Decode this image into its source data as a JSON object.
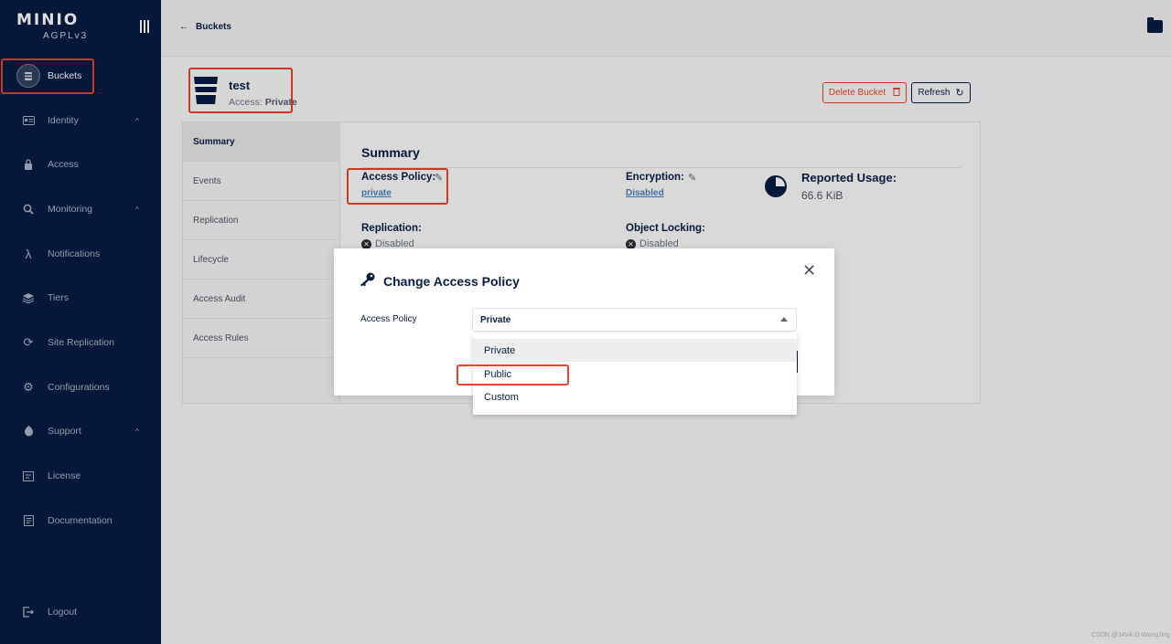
{
  "sidebar": {
    "logo": "MINIO",
    "edition": "AGPLv3",
    "items": [
      {
        "label": "Buckets",
        "icon": "bucket-icon"
      },
      {
        "label": "Identity",
        "icon": "id-card-icon",
        "expandable": true
      },
      {
        "label": "Access",
        "icon": "lock-icon"
      },
      {
        "label": "Monitoring",
        "icon": "magnifier-icon",
        "expandable": true
      },
      {
        "label": "Notifications",
        "icon": "lambda-icon"
      },
      {
        "label": "Tiers",
        "icon": "layers-icon"
      },
      {
        "label": "Site Replication",
        "icon": "sync-icon"
      },
      {
        "label": "Configurations",
        "icon": "gear-icon"
      },
      {
        "label": "Support",
        "icon": "lifebuoy-icon",
        "expandable": true
      },
      {
        "label": "License",
        "icon": "license-icon"
      },
      {
        "label": "Documentation",
        "icon": "document-icon"
      }
    ],
    "logout": "Logout",
    "chevron": "^"
  },
  "topbar": {
    "back_label": "Buckets"
  },
  "bucket": {
    "name": "test",
    "access_prefix": "Access:",
    "access_value": "Private",
    "delete_label": "Delete Bucket",
    "refresh_label": "Refresh"
  },
  "tabs": [
    "Summary",
    "Events",
    "Replication",
    "Lifecycle",
    "Access Audit",
    "Access Rules"
  ],
  "summary": {
    "title": "Summary",
    "access_policy_label": "Access Policy:",
    "access_policy_value": "private",
    "encryption_label": "Encryption:",
    "encryption_value": "Disabled",
    "reported_usage_label": "Reported Usage:",
    "reported_usage_value": "66.6 KiB",
    "replication_label": "Replication:",
    "replication_value": "Disabled",
    "object_locking_label": "Object Locking:",
    "object_locking_value": "Disabled"
  },
  "modal": {
    "title": "Change Access Policy",
    "field_label": "Access Policy",
    "selected": "Private",
    "options": [
      "Private",
      "Public",
      "Custom"
    ]
  },
  "watermark": "CSDN @JAVA-D-WangJing",
  "colors": {
    "sidebar_bg": "#081c42",
    "accent": "#081c42",
    "danger": "#e4442c",
    "link": "#4a7fb4"
  }
}
